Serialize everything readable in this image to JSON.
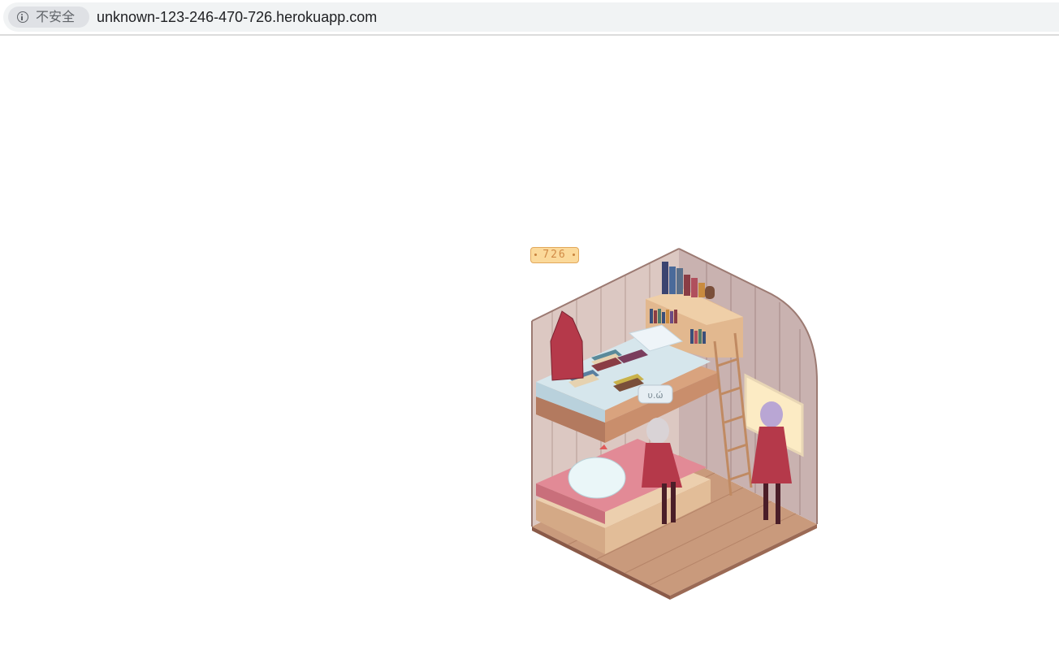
{
  "browser": {
    "security_label": "不安全",
    "url": "unknown-123-246-470-726.herokuapp.com"
  },
  "page": {
    "visit_counter": "726",
    "illustration": {
      "speech_bubble_text": "υ.ώ"
    }
  },
  "colors": {
    "omnibox_bg": "#f1f3f4",
    "chip_bg": "#dfe1e5",
    "counter_bg": "#fbd99a",
    "counter_border": "#e2a85c",
    "counter_text": "#d08a46"
  }
}
